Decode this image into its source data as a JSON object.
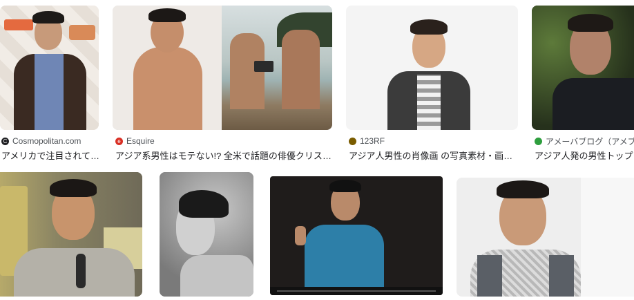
{
  "results": [
    {
      "source": "Cosmopolitan.com",
      "title": "アメリカで注目されて…",
      "favicon_icon": "cosmopolitan-c-icon",
      "favicon_color": "#202124"
    },
    {
      "source": "Esquire",
      "title": "アジア系男性はモテない!? 全米で話題の俳優クリス・…",
      "favicon_icon": "esquire-icon",
      "favicon_color": "#d93025"
    },
    {
      "source": "123RF",
      "title": "アジア人男性の肖像画 の写真素材・画像…",
      "favicon_icon": "123rf-icon",
      "favicon_color": "#7a5c00"
    },
    {
      "source": "アメーバブログ（アメブ",
      "title": "アジア人発の男性トップモ",
      "favicon_icon": "ameba-icon",
      "favicon_color": "#2e9e3e"
    }
  ],
  "colors": {
    "text": "#202124",
    "muted": "#4d5156"
  }
}
